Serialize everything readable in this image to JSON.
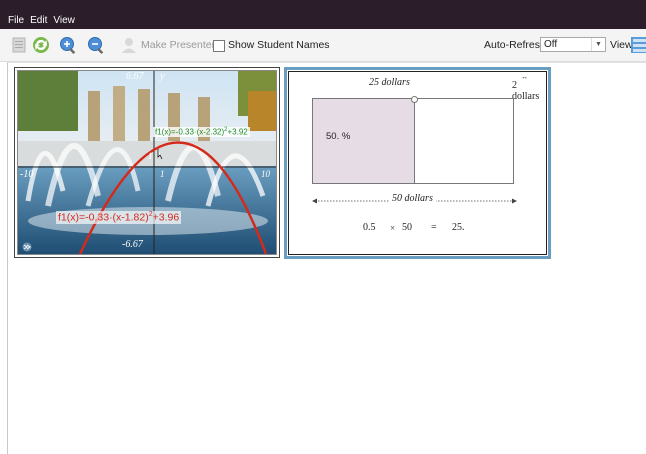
{
  "menu": [
    "File",
    "Edit",
    "View"
  ],
  "toolbar": {
    "make_presenter": "Make Presenter",
    "show_student_names": "Show Student Names",
    "auto_refresh_label": "Auto-Refresh:",
    "auto_refresh_value": "Off",
    "view_label": "View"
  },
  "thumb1": {
    "top_label": "6.67",
    "y_label": "y",
    "x_left": "-10",
    "x_right": "10",
    "x_one": "1",
    "y_one": "1",
    "bottom_label": "-6.67",
    "f1_prefix": "f1(x)=-0.33·(x-1.82)",
    "f1_exp": "2",
    "f1_suffix": "+3.96",
    "f1_green_prefix": "f1(x)=-0.33·(x-2.32)",
    "f1_green_exp": "2",
    "f1_green_suffix": "+3.92",
    "colors": {
      "parabola": "#d42a1c",
      "green": "#1d8a24"
    }
  },
  "thumb2": {
    "top_left": "25 dollars",
    "top_right": "2 dollars",
    "percent": "50. %",
    "bottom_label": "50 dollars",
    "eq_a": "0.5",
    "eq_times": "×",
    "eq_b": "50",
    "eq_equals": "=",
    "eq_result": "25.",
    "colors": {
      "shade": "#e6dce6"
    }
  }
}
